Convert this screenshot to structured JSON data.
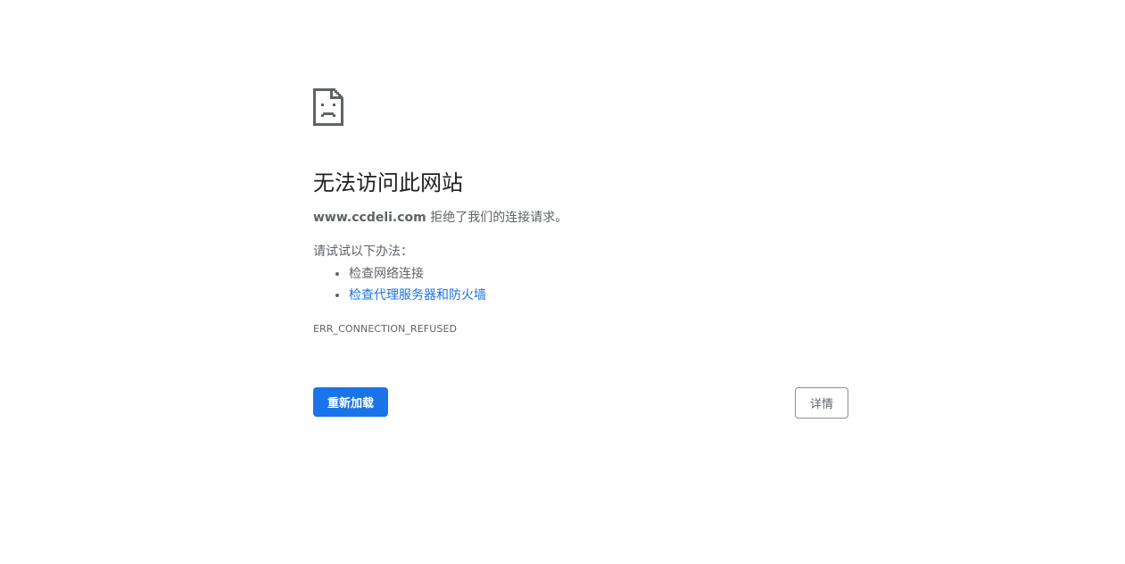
{
  "error_page": {
    "title": "无法访问此网站",
    "host": "www.ccdeli.com",
    "summary_suffix": " 拒绝了我们的连接请求。",
    "suggestions_heading": "请试试以下办法：",
    "suggestions": [
      {
        "label": "检查网络连接",
        "is_link": false
      },
      {
        "label": "检查代理服务器和防火墙",
        "is_link": true
      }
    ],
    "error_code": "ERR_CONNECTION_REFUSED",
    "reload_label": "重新加载",
    "details_label": "详情",
    "icon": "sad-page-icon"
  },
  "colors": {
    "accent": "#1a73e8",
    "text": "#5f6368",
    "title": "#202124"
  }
}
